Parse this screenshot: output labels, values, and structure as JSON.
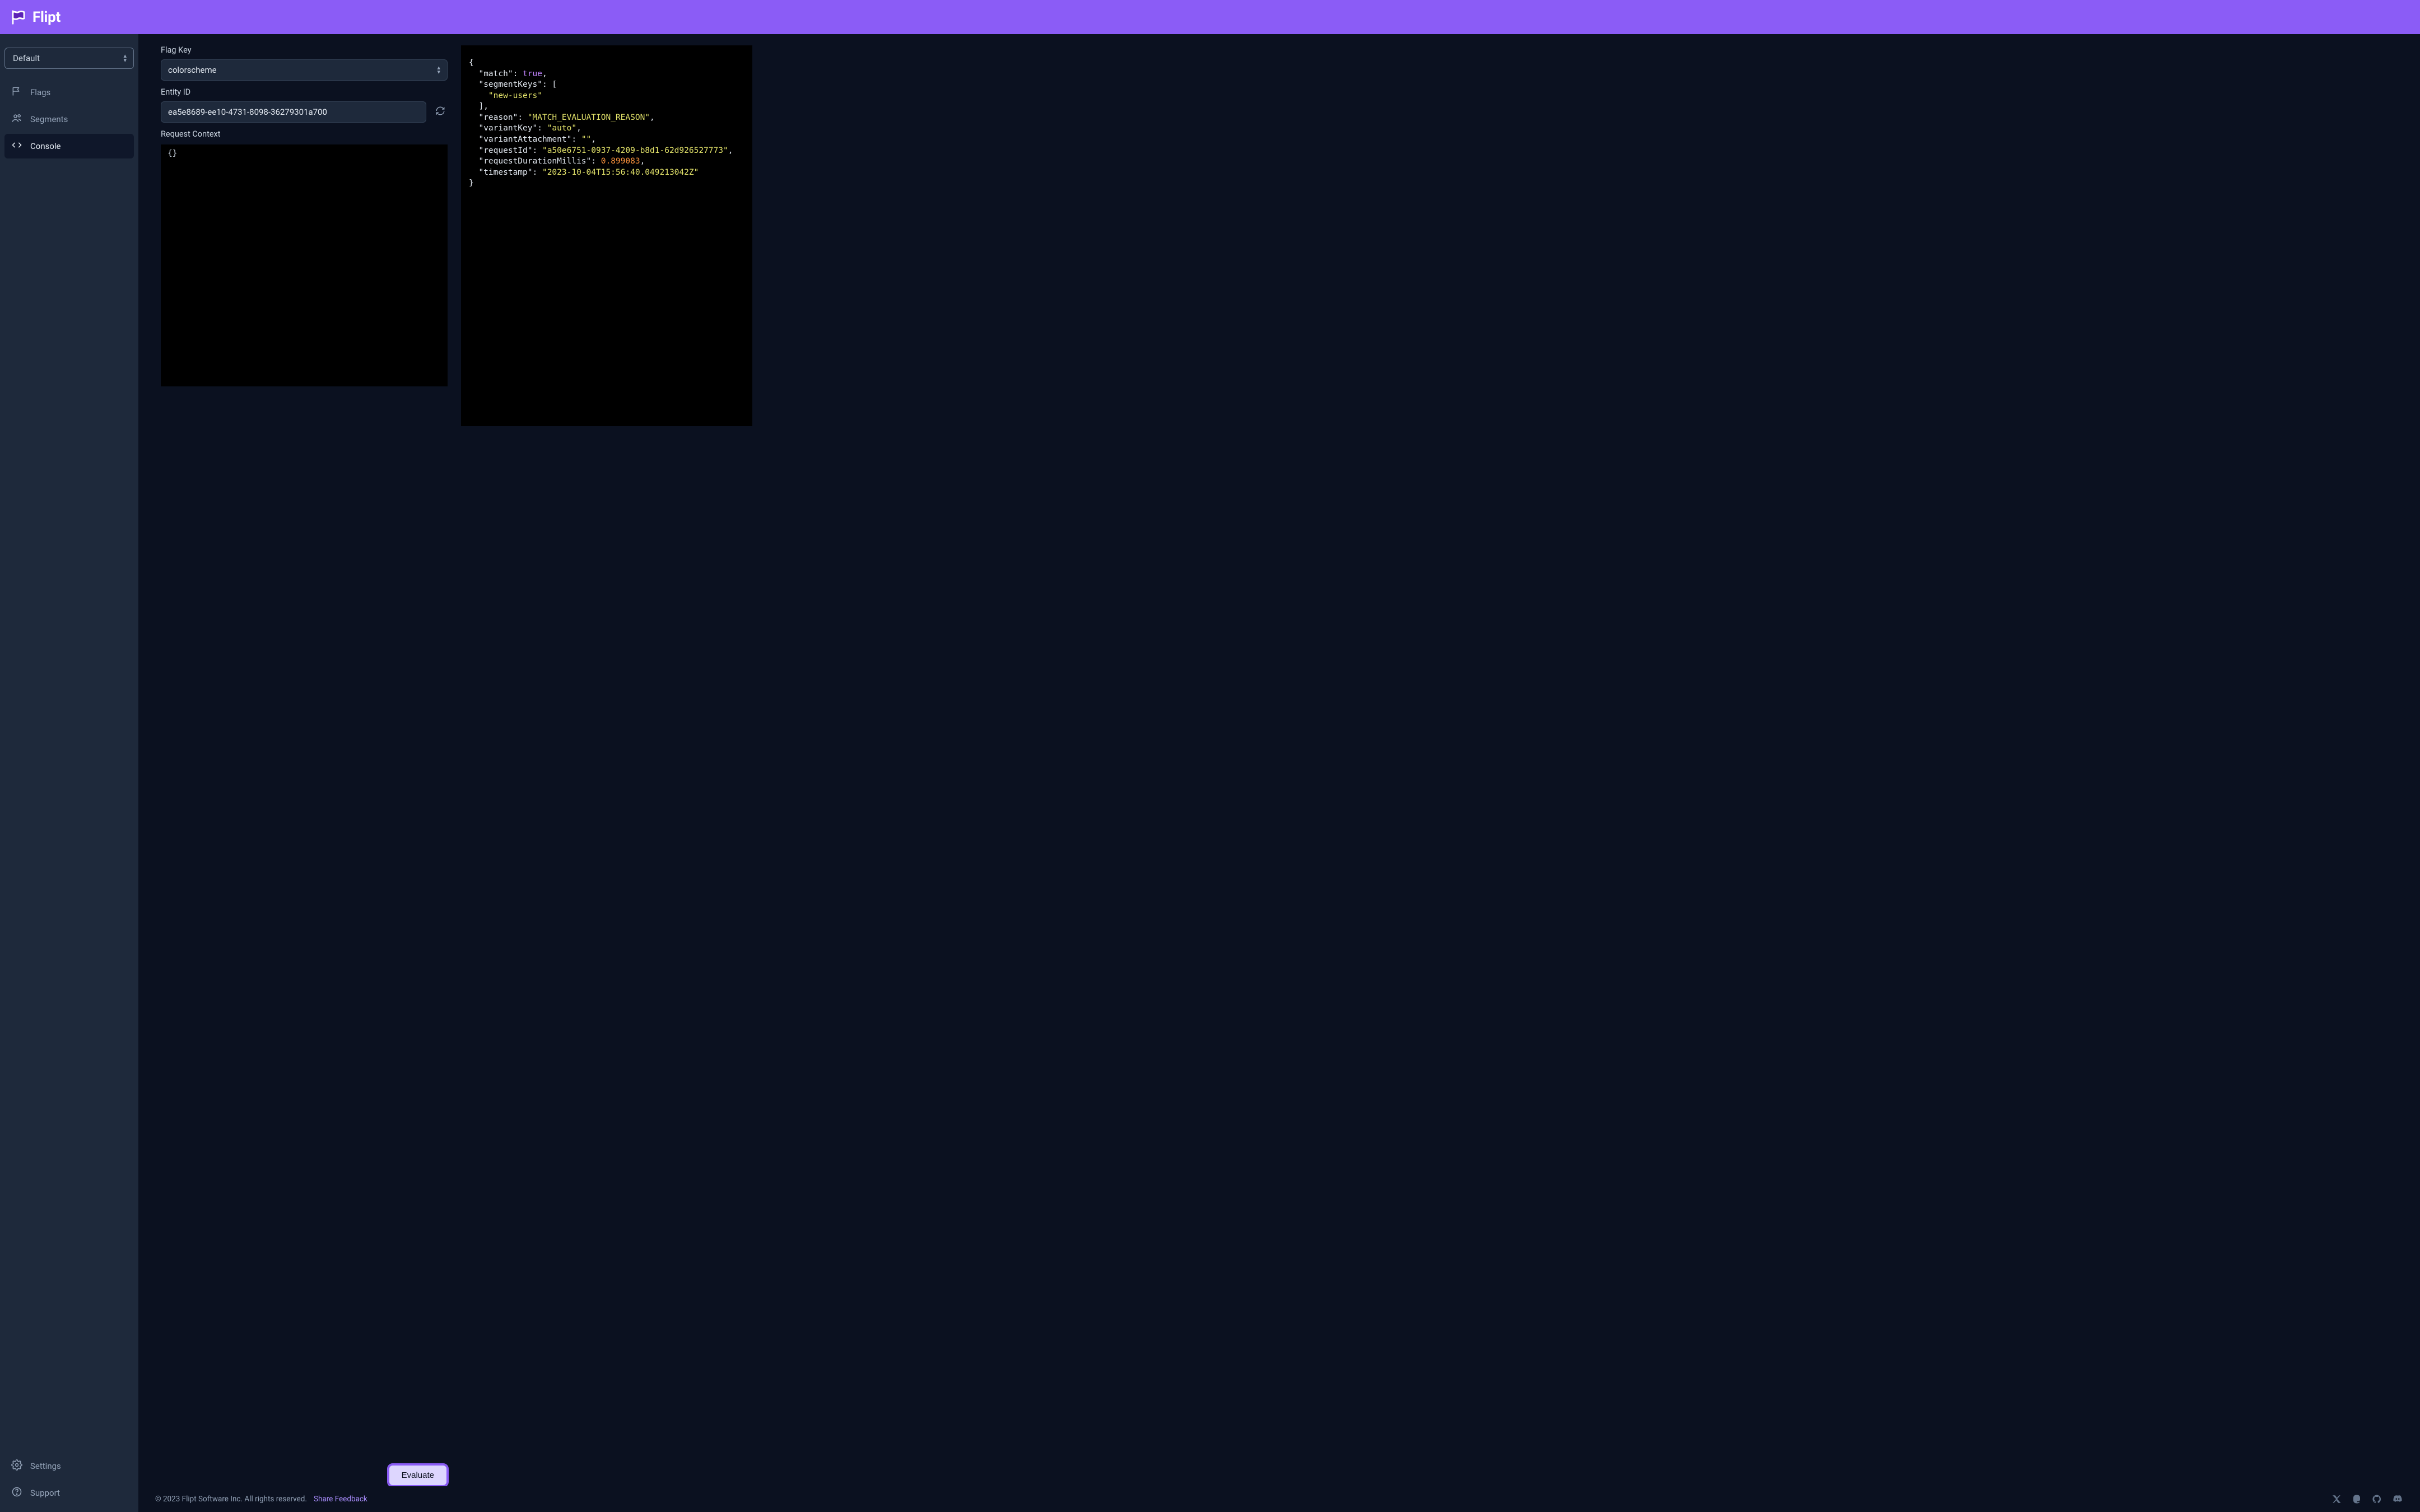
{
  "brand": {
    "name": "Flipt"
  },
  "sidebar": {
    "namespace_selected": "Default",
    "nav": [
      {
        "label": "Flags",
        "icon": "flag-icon"
      },
      {
        "label": "Segments",
        "icon": "users-icon"
      },
      {
        "label": "Console",
        "icon": "code-icon"
      }
    ],
    "nav_bottom": [
      {
        "label": "Settings",
        "icon": "gear-icon"
      },
      {
        "label": "Support",
        "icon": "help-icon"
      }
    ]
  },
  "console": {
    "flag_key_label": "Flag Key",
    "flag_key_value": "colorscheme",
    "entity_id_label": "Entity ID",
    "entity_id_value": "ea5e8689-ee10-4731-8098-36279301a700",
    "request_context_label": "Request Context",
    "request_context_value": "{}",
    "evaluate_label": "Evaluate"
  },
  "response": {
    "match": true,
    "segmentKeys": [
      "new-users"
    ],
    "reason": "MATCH_EVALUATION_REASON",
    "variantKey": "auto",
    "variantAttachment": "",
    "requestId": "a50e6751-0937-4209-b8d1-62d926527773",
    "requestDurationMillis": 0.899083,
    "timestamp": "2023-10-04T15:56:40.049213042Z"
  },
  "footer": {
    "copyright": "© 2023 Flipt Software Inc. All rights reserved.",
    "share_feedback": "Share Feedback"
  }
}
